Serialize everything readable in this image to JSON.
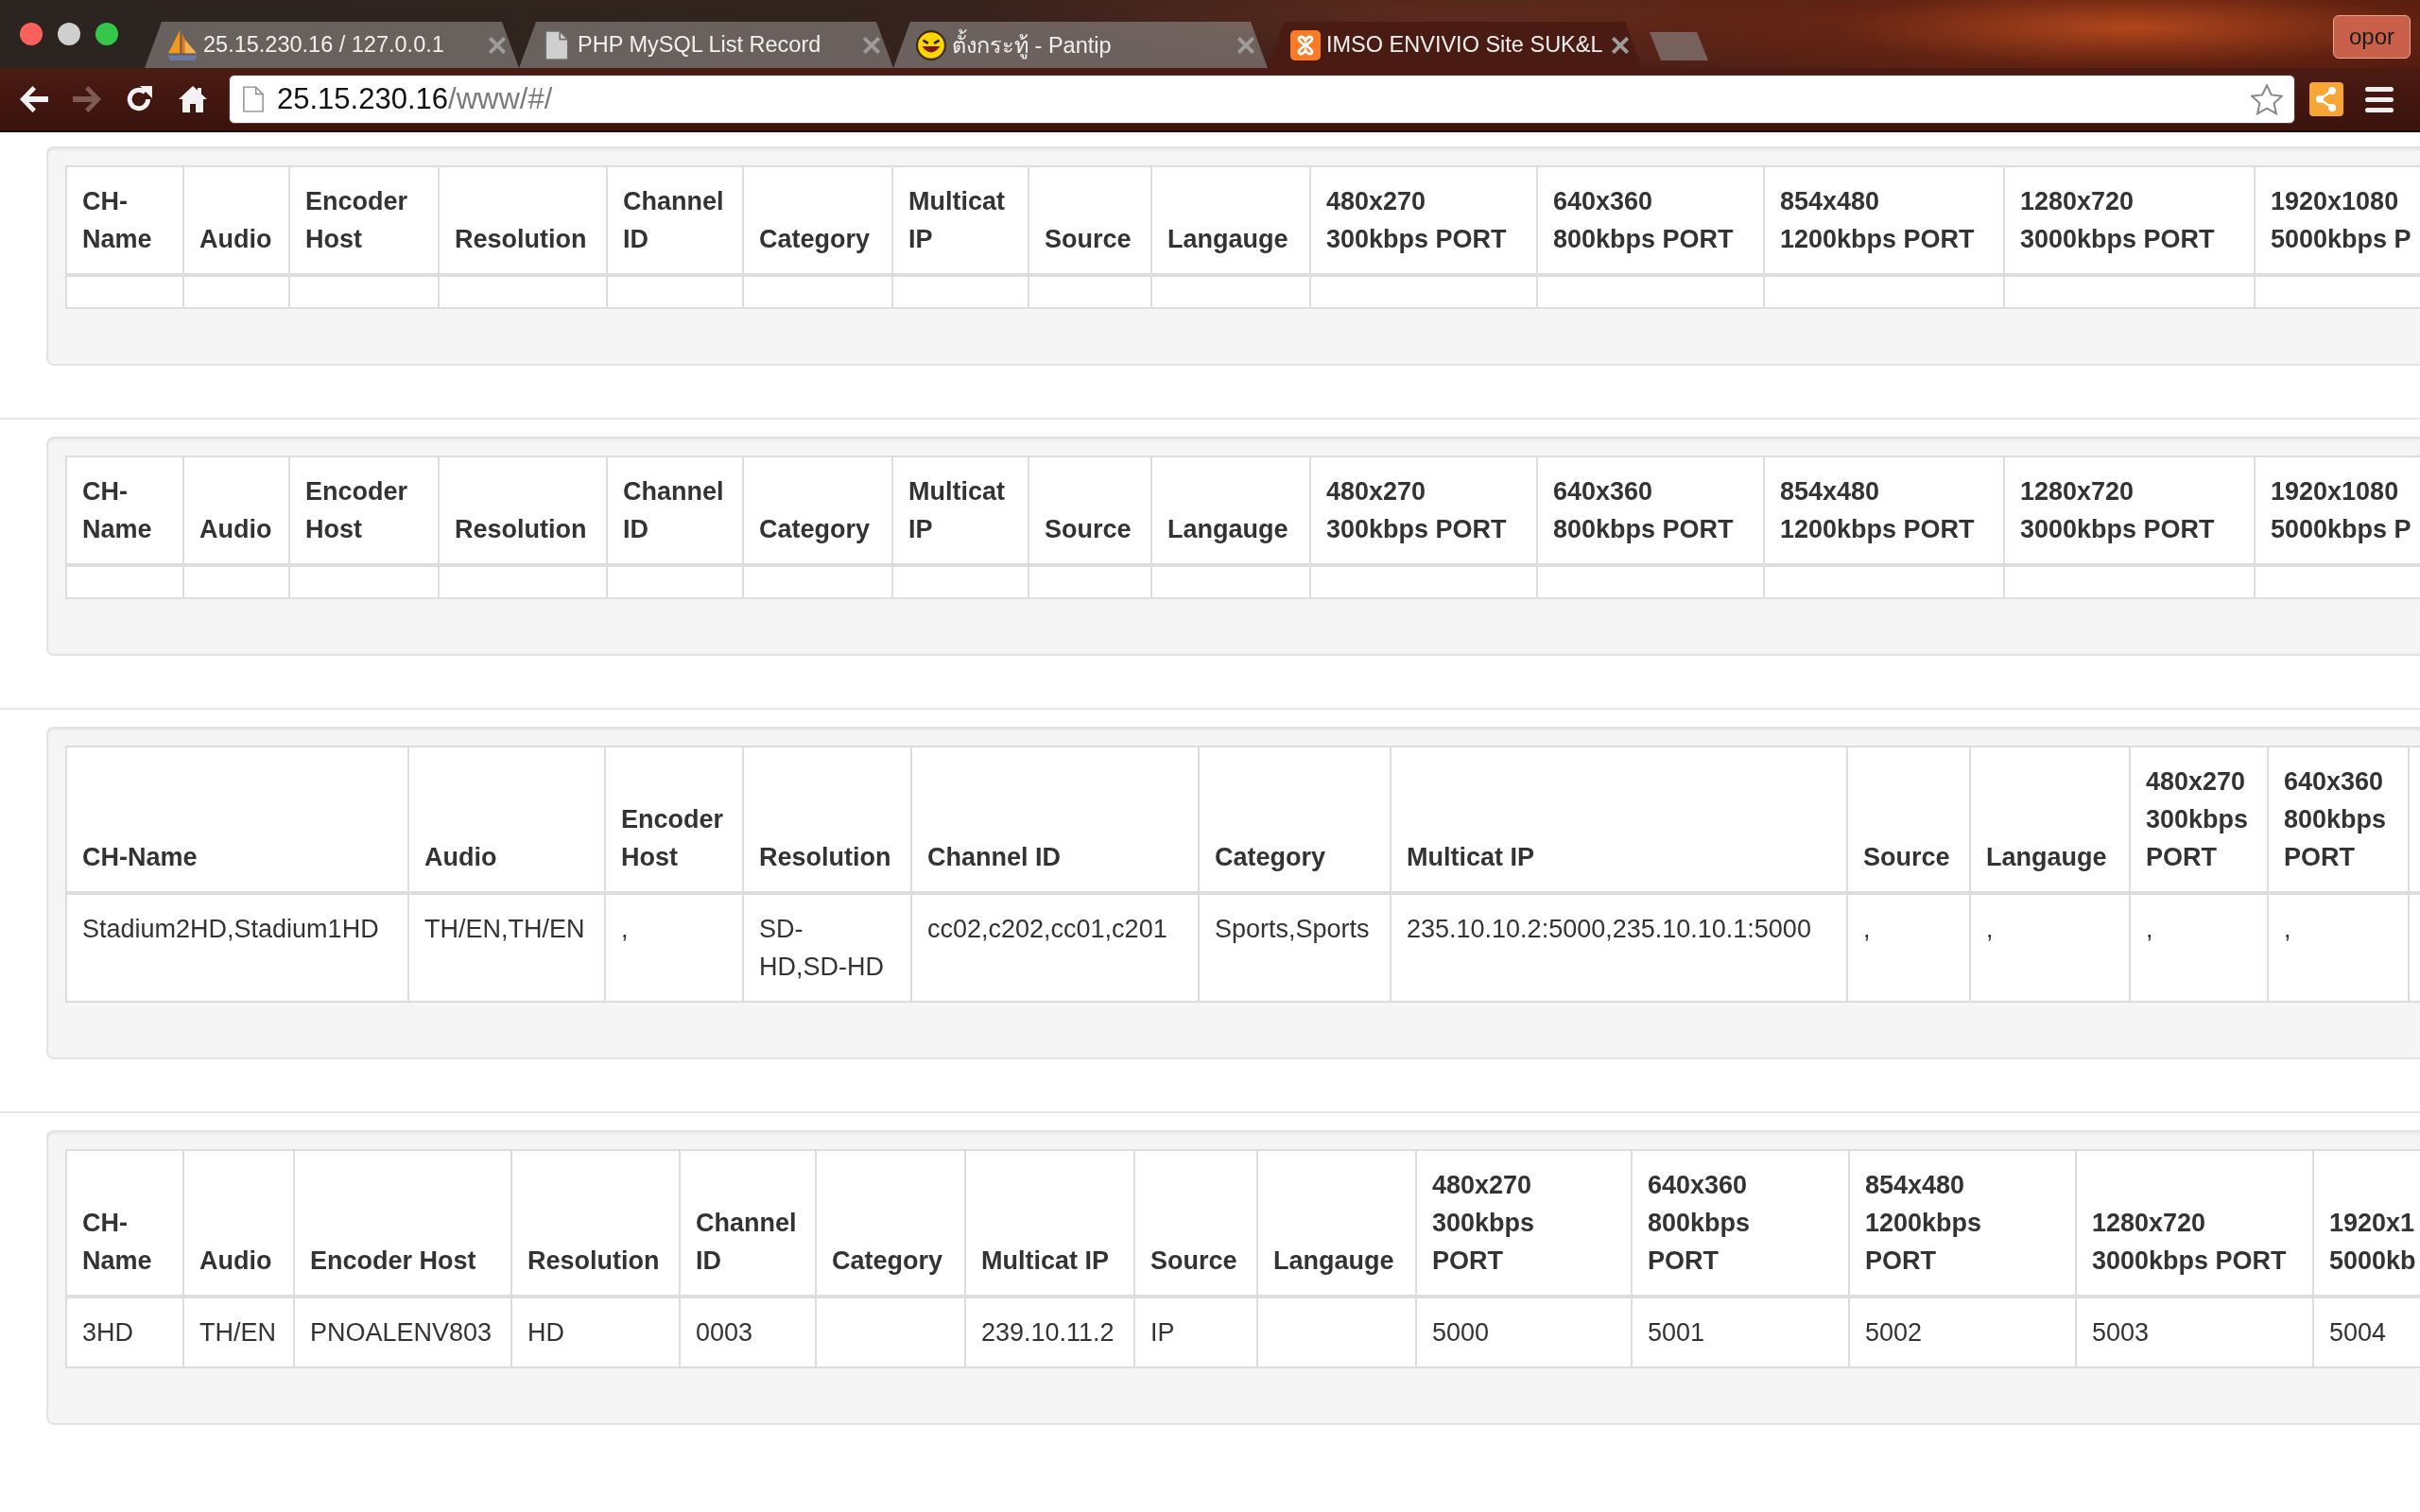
{
  "browser": {
    "tabs": [
      {
        "title": "25.15.230.16 / 127.0.0.1",
        "selected": false
      },
      {
        "title": "PHP MySQL List Record",
        "selected": false
      },
      {
        "title": "ตั้งกระทู้ - Pantip",
        "selected": false
      },
      {
        "title": "IMSO ENVIVIO Site SUK&L",
        "selected": true
      }
    ],
    "profile_button": "opor",
    "nav_buttons": [
      {
        "kind": "back",
        "disabled": false
      },
      {
        "kind": "forward",
        "disabled": true
      },
      {
        "kind": "reload",
        "disabled": false
      },
      {
        "kind": "home",
        "disabled": false
      }
    ],
    "address_bar": {
      "host": "25.15.230.16",
      "path": "/www/#/"
    }
  },
  "panels": [
    {
      "columns": [
        "CH-Name",
        "Audio",
        "Encoder Host",
        "Resolution",
        "Channel ID",
        "Category",
        "Multicat IP",
        "Source",
        "Langauge",
        "480x270 300kbps PORT",
        "640x360 800kbps PORT",
        "854x480 1200kbps PORT",
        "1280x720 3000kbps PORT",
        "1920x1080 5000kbps P"
      ],
      "rows": [
        [
          null,
          null,
          null,
          null,
          null,
          null,
          null,
          null,
          null,
          null,
          null,
          null,
          null,
          null
        ]
      ]
    },
    {
      "columns": [
        "CH-Name",
        "Audio",
        "Encoder Host",
        "Resolution",
        "Channel ID",
        "Category",
        "Multicat IP",
        "Source",
        "Langauge",
        "480x270 300kbps PORT",
        "640x360 800kbps PORT",
        "854x480 1200kbps PORT",
        "1280x720 3000kbps PORT",
        "1920x1080 5000kbps P"
      ],
      "rows": [
        [
          null,
          null,
          null,
          null,
          null,
          null,
          null,
          null,
          null,
          null,
          null,
          null,
          null,
          null
        ]
      ]
    },
    {
      "columns": [
        "CH-Name",
        "Audio",
        "Encoder Host",
        "Resolution",
        "Channel ID",
        "Category",
        "Multicat IP",
        "Source",
        "Langauge",
        "480x270 300kbps PORT",
        "640x360 800kbps PORT"
      ],
      "rows": [
        [
          "Stadium2HD,Stadium1HD",
          "TH/EN,TH/EN",
          ",",
          "SD-HD,SD-HD",
          "cc02,c202,cc01,c201",
          "Sports,Sports",
          "235.10.10.2:5000,235.10.10.1:5000",
          ",",
          ",",
          ",",
          ","
        ]
      ]
    },
    {
      "columns": [
        "CH-Name",
        "Audio",
        "Encoder Host",
        "Resolution",
        "Channel ID",
        "Category",
        "Multicat IP",
        "Source",
        "Langauge",
        "480x270 300kbps PORT",
        "640x360 800kbps PORT",
        "854x480 1200kbps PORT",
        "1280x720 3000kbps PORT",
        "1920x1 5000kb"
      ],
      "rows": [
        [
          "3HD",
          "TH/EN",
          "PNOALENV803",
          "HD",
          "0003",
          null,
          "239.10.11.2",
          "IP",
          null,
          "5000",
          "5001",
          "5002",
          "5003",
          "5004"
        ]
      ]
    }
  ]
}
